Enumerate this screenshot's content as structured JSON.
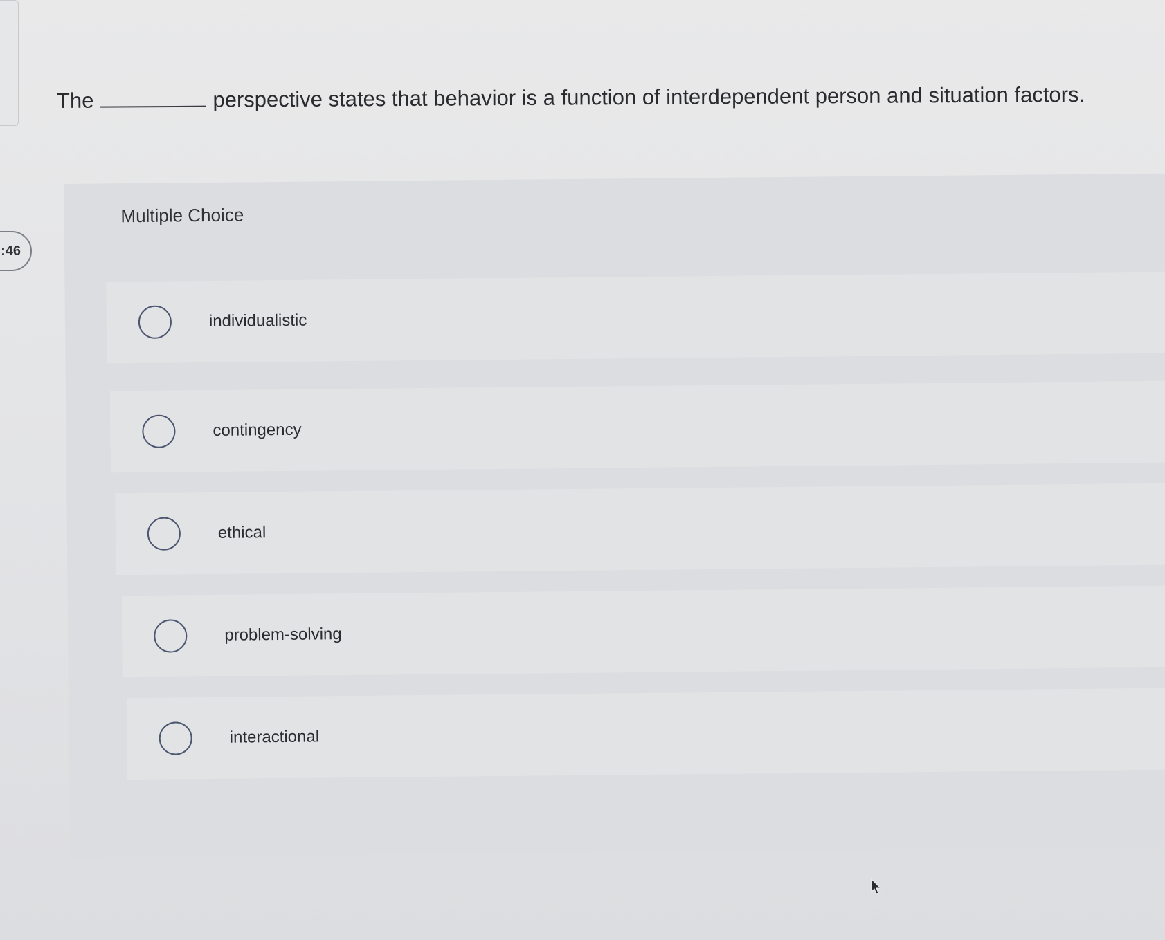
{
  "timer": {
    "text": ":46"
  },
  "question": {
    "before_blank": "The",
    "after_blank": "perspective states that behavior is a function of interdependent person and situation factors."
  },
  "multiple_choice": {
    "heading": "Multiple Choice",
    "options": [
      {
        "label": "individualistic"
      },
      {
        "label": "contingency"
      },
      {
        "label": "ethical"
      },
      {
        "label": "problem-solving"
      },
      {
        "label": "interactional"
      }
    ]
  },
  "icons": {
    "radio": "radio-button-icon",
    "cursor": "mouse-pointer-icon"
  }
}
